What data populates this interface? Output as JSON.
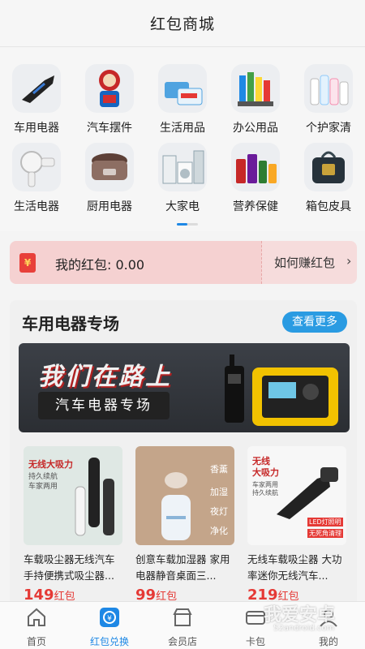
{
  "header": {
    "title": "红包商城"
  },
  "categories": [
    {
      "label": "车用电器",
      "icon": "car-vacuum-icon"
    },
    {
      "label": "汽车摆件",
      "icon": "car-ornament-icon"
    },
    {
      "label": "生活用品",
      "icon": "daily-goods-icon"
    },
    {
      "label": "办公用品",
      "icon": "office-supplies-icon"
    },
    {
      "label": "个护家清",
      "icon": "personal-care-icon"
    },
    {
      "label": "生活电器",
      "icon": "hair-dryer-icon"
    },
    {
      "label": "厨用电器",
      "icon": "rice-cooker-icon"
    },
    {
      "label": "大家电",
      "icon": "appliances-icon"
    },
    {
      "label": "营养保健",
      "icon": "supplements-icon"
    },
    {
      "label": "箱包皮具",
      "icon": "bag-icon"
    }
  ],
  "redpacket": {
    "label": "我的红包: 0.00",
    "howto": "如何赚红包",
    "chevron": "›",
    "env_glyph": "¥"
  },
  "section": {
    "title": "车用电器专场",
    "more": "查看更多",
    "banner": {
      "headline": "我们在路上",
      "subtitle": "汽车电器专场"
    },
    "products": [
      {
        "name": "车载吸尘器无线汽车手持便携式吸尘器...",
        "price": "149",
        "unit": "红包",
        "img_text": [
          "无线大吸力",
          "持久续航",
          "车家两用"
        ]
      },
      {
        "name": "创意车载加湿器 家用电器静音桌面三...",
        "price": "99",
        "unit": "红包",
        "img_text": [
          "香薰",
          "加湿",
          "夜灯",
          "净化"
        ]
      },
      {
        "name": "无线车载吸尘器 大功率迷你无线汽车...",
        "price": "219",
        "unit": "红包",
        "img_text": [
          "无线",
          "大吸力",
          "车家两用",
          "持久续航",
          "LED灯照明",
          "无死角清理"
        ]
      }
    ]
  },
  "tabs": [
    {
      "label": "首页",
      "icon": "home-icon"
    },
    {
      "label": "红包兑换",
      "icon": "redpacket-exchange-icon",
      "active": true
    },
    {
      "label": "会员店",
      "icon": "store-icon"
    },
    {
      "label": "卡包",
      "icon": "card-icon"
    },
    {
      "label": "我的",
      "icon": "profile-icon"
    }
  ],
  "watermark": {
    "text": "我爱安卓",
    "url": "52android.com"
  },
  "colors": {
    "accent": "#1e88e5",
    "price": "#e53935",
    "more_btn": "#2a9be2",
    "redbar": "#f6dcdc"
  }
}
